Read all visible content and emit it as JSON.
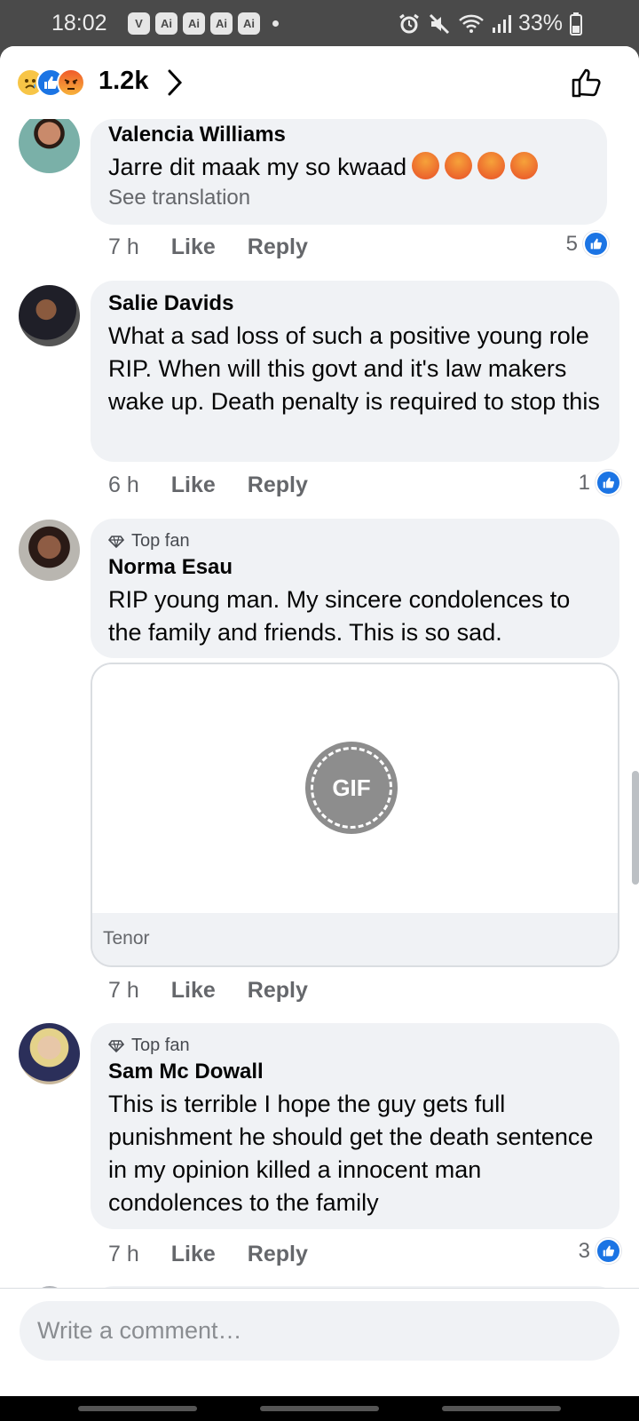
{
  "status_bar": {
    "time": "18:02",
    "app_icons": [
      "V",
      "Ai",
      "Ai",
      "Ai",
      "Ai"
    ],
    "battery": "33%"
  },
  "header": {
    "reaction_icons": [
      "sad-reaction-icon",
      "like-reaction-icon",
      "angry-reaction-icon"
    ],
    "reaction_count": "1.2k"
  },
  "comments": [
    {
      "name": "Valencia Williams",
      "top_fan": false,
      "text": "Jarre dit maak my so kwaad",
      "emoji_count": 4,
      "see_translation": "See translation",
      "time": "7 h",
      "like_label": "Like",
      "reply_label": "Reply",
      "likes": "5"
    },
    {
      "name": "Salie Davids",
      "top_fan": false,
      "text": "What a sad loss of such a positive young role RIP. When will this govt and it's law makers wake up. Death penalty is required to stop this",
      "time": "6 h",
      "like_label": "Like",
      "reply_label": "Reply",
      "likes": "1"
    },
    {
      "name": "Norma Esau",
      "top_fan": true,
      "badge": "Top fan",
      "text": "RIP young man. My sincere condolences to the family and friends. This is so sad.",
      "gif": {
        "badge": "GIF",
        "source": "Tenor"
      },
      "time": "7 h",
      "like_label": "Like",
      "reply_label": "Reply"
    },
    {
      "name": "Sam Mc Dowall",
      "top_fan": true,
      "badge": "Top fan",
      "text": "This is terrible I hope the guy gets full punishment he should get the death sentence in my opinion killed a innocent man condolences to the family",
      "time": "7 h",
      "like_label": "Like",
      "reply_label": "Reply",
      "likes": "3"
    }
  ],
  "composer": {
    "placeholder": "Write a comment…"
  },
  "colors": {
    "accent": "#1b74e4",
    "bubble": "#f0f2f5",
    "muted_text": "#65676b"
  }
}
